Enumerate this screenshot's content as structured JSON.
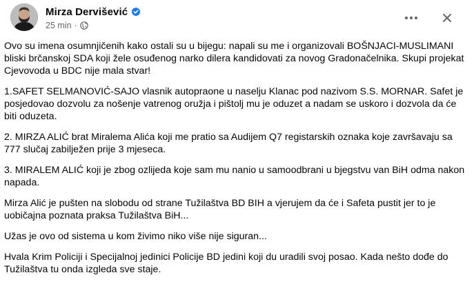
{
  "post": {
    "author": "Mirza Dervišević",
    "timestamp": "25 min",
    "separator": "·",
    "verified_icon": "verified-badge-icon",
    "privacy_icon": "globe-icon",
    "more_icon": "more-horizontal-icon",
    "close_icon": "close-icon",
    "accent_color": "#1877f2",
    "paragraphs": [
      "Ovo su imena osumnjičenih kako ostali su u bijegu: napali su me i organizovali BOŠNJACI-MUSLIMANI bliski brčanskoj SDA koji žele osuđenog narko dilera kandidovati za novog Gradonačelnika. Skupi projekat Cjevovoda u BDC nije mala stvar!",
      "1.SAFET SELMANOVIĆ-SAJO vlasnik autopraone u naselju Klanac pod nazivom S.S. MORNAR. Safet je posjedovao dozvolu za nošenje vatrenog oružja i pištolj mu je oduzet a nadam se uskoro i dozvola da će biti oduzeta.",
      "2. MIRZA ALIĆ brat Miralema Alića koji me pratio sa Audijem Q7 registarskih oznaka koje završavaju sa 777 slučaj zabilježen prije 3 mjeseca.",
      "3. MIRALEM ALIĆ koji je zbog ozlijeda koje sam mu nanio u samoodbrani u bjegstvu van BiH odma nakon napada.",
      "Mirza Alić je pušten na slobodu od strane Tužilaštva BD BIH a vjerujem da će i Safeta pustit jer to je uobičajna poznata praksa Tužilaštva BiH...",
      "Užas je ovo od sistema u kom živimo niko više nije siguran...",
      "Hvala Krim Policiji i Specijalnoj jedinici Policije BD jedini koji du uradili svoj posao. Kada nešto dođe do Tužilaštva tu onda izgleda sve staje."
    ]
  }
}
